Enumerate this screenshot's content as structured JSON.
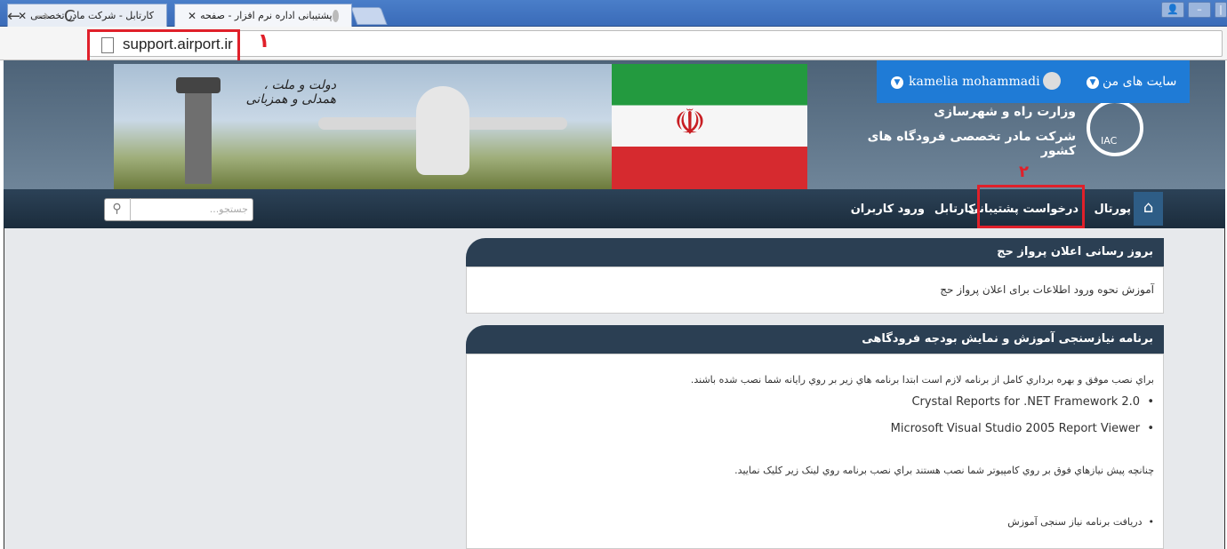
{
  "browser": {
    "tabs": [
      {
        "title": "پشتیبانی اداره نرم افزار - صفحه"
      },
      {
        "title": "کارتابل - شرکت مادر تخصصی"
      }
    ],
    "url": "support.airport.ir",
    "annotation_1": "۱",
    "annotation_2": "۲"
  },
  "header": {
    "slogan_line1": "دولت و ملت ،",
    "slogan_line2": "همدلی و همزبانی",
    "org_ministry": "وزارت راه و شهرسازی",
    "org_name": "شرکت مادر تخصصی فرودگاه های کشور",
    "logo_text": "IAC"
  },
  "userbar": {
    "my_sites": "سایت های من",
    "username": "kamelia mohammadi"
  },
  "nav": {
    "items": [
      "پورتال",
      "درخواست پشتیبانی",
      "کارتابل",
      "ورود کاربران"
    ],
    "search_placeholder": "جستجو..."
  },
  "panels": [
    {
      "title": "بروز رسانی اعلان پرواز حج",
      "lines": [
        "آموزش نحوه ورود اطلاعات برای اعلان پرواز حج"
      ]
    },
    {
      "title": "برنامه نیازسنجی آموزش و نمایش بودجه فرودگاهی",
      "intro": "براي نصب موفق و بهره برداري كامل از برنامه لازم است ابتدا برنامه هاي زير بر روي رايانه شما نصب شده باشند.",
      "bullets": [
        "Crystal Reports for .NET Framework 2.0",
        "Microsoft Visual Studio 2005 Report Viewer"
      ],
      "note": "چنانچه پيش نيازهاي فوق بر روي كامپيوتر شما نصب هستند براي نصب برنامه روي لينک زير کليک نماييد.",
      "link": "دریافت برنامه نیاز سنجی آموزش"
    }
  ]
}
